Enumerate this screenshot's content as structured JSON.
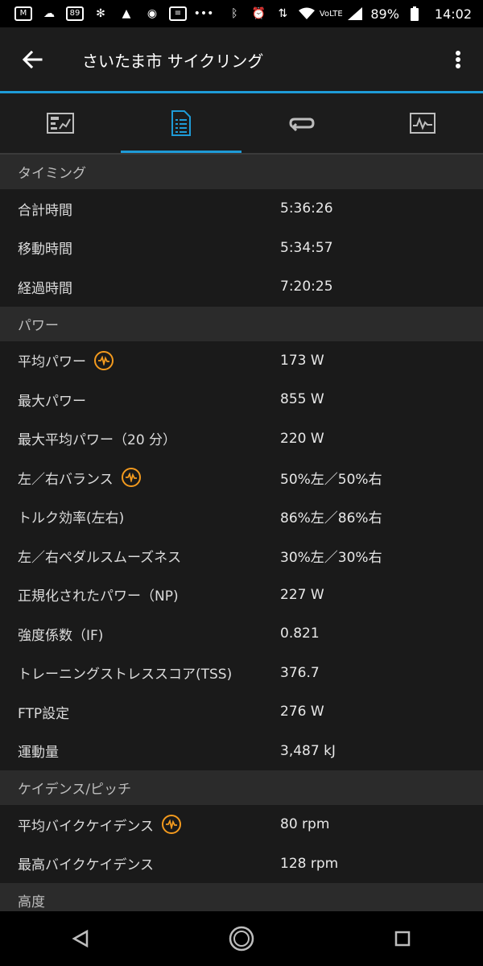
{
  "status_bar": {
    "battery": "89%",
    "time": "14:02",
    "left_icons": [
      "gmail-icon",
      "weather-icon",
      "calendar-icon",
      "pinwheel-icon",
      "garmin-icon",
      "compass-icon",
      "news-icon",
      "more-icon"
    ],
    "right_icons": [
      "bluetooth-icon",
      "alarm-icon",
      "data-icon",
      "wifi-icon",
      "volte-icon",
      "signal-icon",
      "battery-icon"
    ]
  },
  "app_bar": {
    "title": "さいたま市 サイクリング"
  },
  "tabs": [
    {
      "name": "overview",
      "icon": "overview-icon",
      "active": false
    },
    {
      "name": "stats",
      "icon": "stats-icon",
      "active": true
    },
    {
      "name": "laps",
      "icon": "laps-icon",
      "active": false
    },
    {
      "name": "charts",
      "icon": "charts-icon",
      "active": false
    }
  ],
  "sections": [
    {
      "title": "タイミング",
      "rows": [
        {
          "label": "合計時間",
          "value": "5:36:26",
          "badge": false
        },
        {
          "label": "移動時間",
          "value": "5:34:57",
          "badge": false
        },
        {
          "label": "経過時間",
          "value": "7:20:25",
          "badge": false
        }
      ]
    },
    {
      "title": "パワー",
      "rows": [
        {
          "label": "平均パワー",
          "value": "173 W",
          "badge": true
        },
        {
          "label": "最大パワー",
          "value": "855 W",
          "badge": false
        },
        {
          "label": "最大平均パワー（20 分）",
          "value": "220 W",
          "badge": false
        },
        {
          "label": "左／右バランス",
          "value": "50%左／50%右",
          "badge": true
        },
        {
          "label": "トルク効率(左右)",
          "value": "86%左／86%右",
          "badge": false
        },
        {
          "label": "左／右ペダルスムーズネス",
          "value": "30%左／30%右",
          "badge": false
        },
        {
          "label": "正規化されたパワー（NP)",
          "value": "227 W",
          "badge": false
        },
        {
          "label": "強度係数（IF)",
          "value": "0.821",
          "badge": false
        },
        {
          "label": "トレーニングストレススコア(TSS)",
          "value": "376.7",
          "badge": false
        },
        {
          "label": "FTP設定",
          "value": "276 W",
          "badge": false
        },
        {
          "label": "運動量",
          "value": "3,487 kJ",
          "badge": false
        }
      ]
    },
    {
      "title": "ケイデンス/ピッチ",
      "rows": [
        {
          "label": "平均バイクケイデンス",
          "value": "80 rpm",
          "badge": true
        },
        {
          "label": "最高バイクケイデンス",
          "value": "128 rpm",
          "badge": false
        }
      ]
    },
    {
      "title": "高度",
      "rows": []
    }
  ],
  "colors": {
    "accent": "#1e9bd7",
    "badge": "#f39a1e",
    "header_bg": "#2b2b2b",
    "row_bg": "#1a1a1a"
  }
}
